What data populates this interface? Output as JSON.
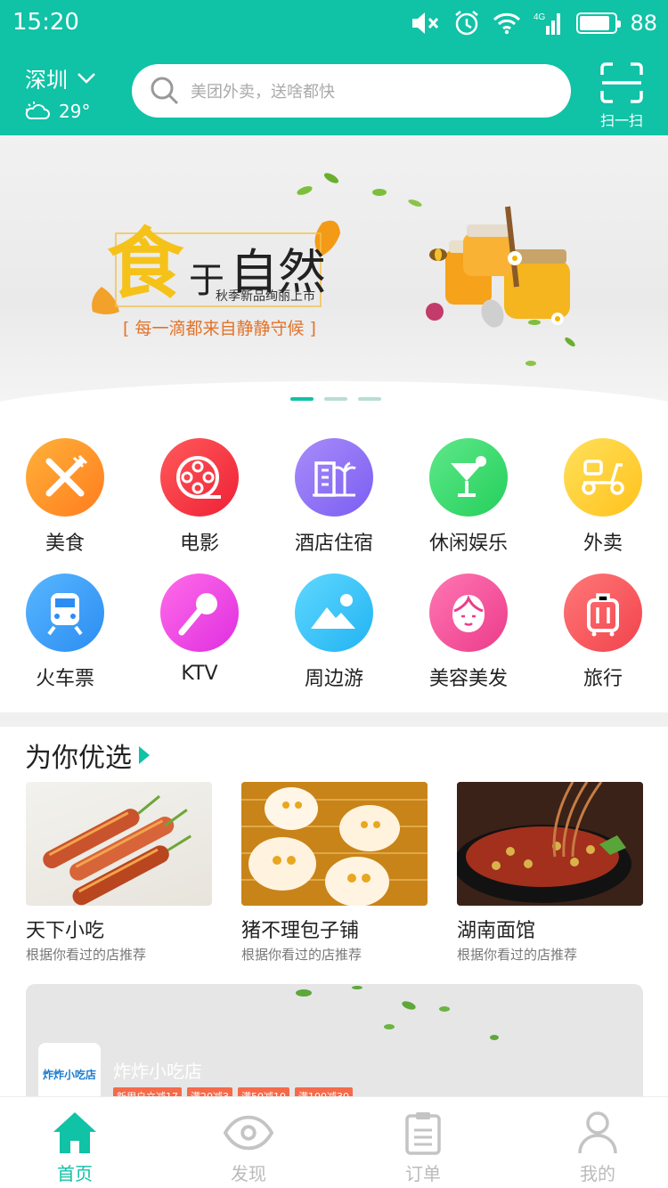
{
  "status": {
    "time": "15:20",
    "network": "4G",
    "battery": "88",
    "battery_level": 0.88
  },
  "header": {
    "city": "深圳",
    "temperature": "29°",
    "search_placeholder": "美团外卖，送啥都快",
    "scan_label": "扫一扫"
  },
  "banner": {
    "title_1": "食",
    "title_2": "于",
    "title_3": "自然",
    "subtitle": "秋季新品绚丽上市",
    "slogan": "[ 每一滴都来自静静守候 ]",
    "dot_count": 3,
    "active_dot": 0
  },
  "categories": [
    {
      "label": "美食",
      "icon": "fork-knife-icon",
      "color1": "#ffb13a",
      "color2": "#ff7d1e"
    },
    {
      "label": "电影",
      "icon": "film-reel-icon",
      "color1": "#ff5a5a",
      "color2": "#ee2136"
    },
    {
      "label": "酒店住宿",
      "icon": "hotel-icon",
      "color1": "#a88cf9",
      "color2": "#7b5ef2"
    },
    {
      "label": "休闲娱乐",
      "icon": "cocktail-icon",
      "color1": "#5ee889",
      "color2": "#25cf5c"
    },
    {
      "label": "外卖",
      "icon": "scooter-icon",
      "color1": "#ffe05a",
      "color2": "#ffc21d"
    },
    {
      "label": "火车票",
      "icon": "train-icon",
      "color1": "#58b6ff",
      "color2": "#2b8df2"
    },
    {
      "label": "KTV",
      "icon": "microphone-icon",
      "color1": "#ff6ce8",
      "color2": "#df2ee0"
    },
    {
      "label": "周边游",
      "icon": "mountain-icon",
      "color1": "#5fd8ff",
      "color2": "#22b3f2"
    },
    {
      "label": "美容美发",
      "icon": "face-icon",
      "color1": "#ff77b3",
      "color2": "#ec3b8a"
    },
    {
      "label": "旅行",
      "icon": "luggage-icon",
      "color1": "#ff7878",
      "color2": "#f1434c"
    }
  ],
  "recommend": {
    "title": "为你优选",
    "items": [
      {
        "name": "天下小吃",
        "desc": "根据你看过的店推荐"
      },
      {
        "name": "猪不理包子铺",
        "desc": "根据你看过的店推荐"
      },
      {
        "name": "湖南面馆",
        "desc": "根据你看过的店推荐"
      }
    ]
  },
  "promo": {
    "logo_text": "炸炸小吃店",
    "shop_name": "炸炸小吃店",
    "tags": [
      "新用户立减17",
      "满20减3",
      "满50减10",
      "满100减30"
    ]
  },
  "tabs": [
    {
      "label": "首页",
      "icon": "home-icon",
      "active": true
    },
    {
      "label": "发现",
      "icon": "eye-icon",
      "active": false
    },
    {
      "label": "订单",
      "icon": "clipboard-icon",
      "active": false
    },
    {
      "label": "我的",
      "icon": "person-icon",
      "active": false
    }
  ],
  "colors": {
    "accent": "#10c2a6",
    "tag": "#f56a4a"
  }
}
